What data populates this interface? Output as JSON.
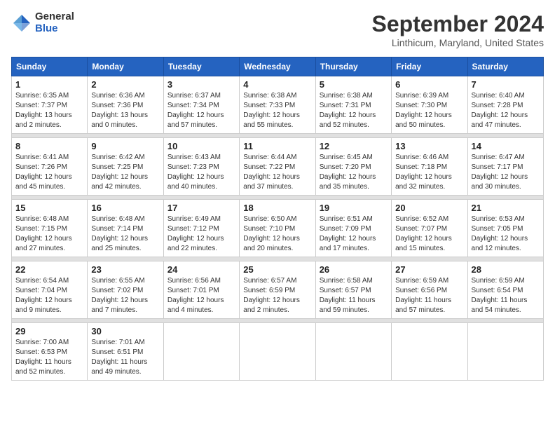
{
  "logo": {
    "general": "General",
    "blue": "Blue"
  },
  "title": "September 2024",
  "location": "Linthicum, Maryland, United States",
  "headers": [
    "Sunday",
    "Monday",
    "Tuesday",
    "Wednesday",
    "Thursday",
    "Friday",
    "Saturday"
  ],
  "weeks": [
    [
      {
        "day": "1",
        "sunrise": "6:35 AM",
        "sunset": "7:37 PM",
        "daylight": "13 hours and 2 minutes."
      },
      {
        "day": "2",
        "sunrise": "6:36 AM",
        "sunset": "7:36 PM",
        "daylight": "13 hours and 0 minutes."
      },
      {
        "day": "3",
        "sunrise": "6:37 AM",
        "sunset": "7:34 PM",
        "daylight": "12 hours and 57 minutes."
      },
      {
        "day": "4",
        "sunrise": "6:38 AM",
        "sunset": "7:33 PM",
        "daylight": "12 hours and 55 minutes."
      },
      {
        "day": "5",
        "sunrise": "6:38 AM",
        "sunset": "7:31 PM",
        "daylight": "12 hours and 52 minutes."
      },
      {
        "day": "6",
        "sunrise": "6:39 AM",
        "sunset": "7:30 PM",
        "daylight": "12 hours and 50 minutes."
      },
      {
        "day": "7",
        "sunrise": "6:40 AM",
        "sunset": "7:28 PM",
        "daylight": "12 hours and 47 minutes."
      }
    ],
    [
      {
        "day": "8",
        "sunrise": "6:41 AM",
        "sunset": "7:26 PM",
        "daylight": "12 hours and 45 minutes."
      },
      {
        "day": "9",
        "sunrise": "6:42 AM",
        "sunset": "7:25 PM",
        "daylight": "12 hours and 42 minutes."
      },
      {
        "day": "10",
        "sunrise": "6:43 AM",
        "sunset": "7:23 PM",
        "daylight": "12 hours and 40 minutes."
      },
      {
        "day": "11",
        "sunrise": "6:44 AM",
        "sunset": "7:22 PM",
        "daylight": "12 hours and 37 minutes."
      },
      {
        "day": "12",
        "sunrise": "6:45 AM",
        "sunset": "7:20 PM",
        "daylight": "12 hours and 35 minutes."
      },
      {
        "day": "13",
        "sunrise": "6:46 AM",
        "sunset": "7:18 PM",
        "daylight": "12 hours and 32 minutes."
      },
      {
        "day": "14",
        "sunrise": "6:47 AM",
        "sunset": "7:17 PM",
        "daylight": "12 hours and 30 minutes."
      }
    ],
    [
      {
        "day": "15",
        "sunrise": "6:48 AM",
        "sunset": "7:15 PM",
        "daylight": "12 hours and 27 minutes."
      },
      {
        "day": "16",
        "sunrise": "6:48 AM",
        "sunset": "7:14 PM",
        "daylight": "12 hours and 25 minutes."
      },
      {
        "day": "17",
        "sunrise": "6:49 AM",
        "sunset": "7:12 PM",
        "daylight": "12 hours and 22 minutes."
      },
      {
        "day": "18",
        "sunrise": "6:50 AM",
        "sunset": "7:10 PM",
        "daylight": "12 hours and 20 minutes."
      },
      {
        "day": "19",
        "sunrise": "6:51 AM",
        "sunset": "7:09 PM",
        "daylight": "12 hours and 17 minutes."
      },
      {
        "day": "20",
        "sunrise": "6:52 AM",
        "sunset": "7:07 PM",
        "daylight": "12 hours and 15 minutes."
      },
      {
        "day": "21",
        "sunrise": "6:53 AM",
        "sunset": "7:05 PM",
        "daylight": "12 hours and 12 minutes."
      }
    ],
    [
      {
        "day": "22",
        "sunrise": "6:54 AM",
        "sunset": "7:04 PM",
        "daylight": "12 hours and 9 minutes."
      },
      {
        "day": "23",
        "sunrise": "6:55 AM",
        "sunset": "7:02 PM",
        "daylight": "12 hours and 7 minutes."
      },
      {
        "day": "24",
        "sunrise": "6:56 AM",
        "sunset": "7:01 PM",
        "daylight": "12 hours and 4 minutes."
      },
      {
        "day": "25",
        "sunrise": "6:57 AM",
        "sunset": "6:59 PM",
        "daylight": "12 hours and 2 minutes."
      },
      {
        "day": "26",
        "sunrise": "6:58 AM",
        "sunset": "6:57 PM",
        "daylight": "11 hours and 59 minutes."
      },
      {
        "day": "27",
        "sunrise": "6:59 AM",
        "sunset": "6:56 PM",
        "daylight": "11 hours and 57 minutes."
      },
      {
        "day": "28",
        "sunrise": "6:59 AM",
        "sunset": "6:54 PM",
        "daylight": "11 hours and 54 minutes."
      }
    ],
    [
      {
        "day": "29",
        "sunrise": "7:00 AM",
        "sunset": "6:53 PM",
        "daylight": "11 hours and 52 minutes."
      },
      {
        "day": "30",
        "sunrise": "7:01 AM",
        "sunset": "6:51 PM",
        "daylight": "11 hours and 49 minutes."
      },
      null,
      null,
      null,
      null,
      null
    ]
  ]
}
